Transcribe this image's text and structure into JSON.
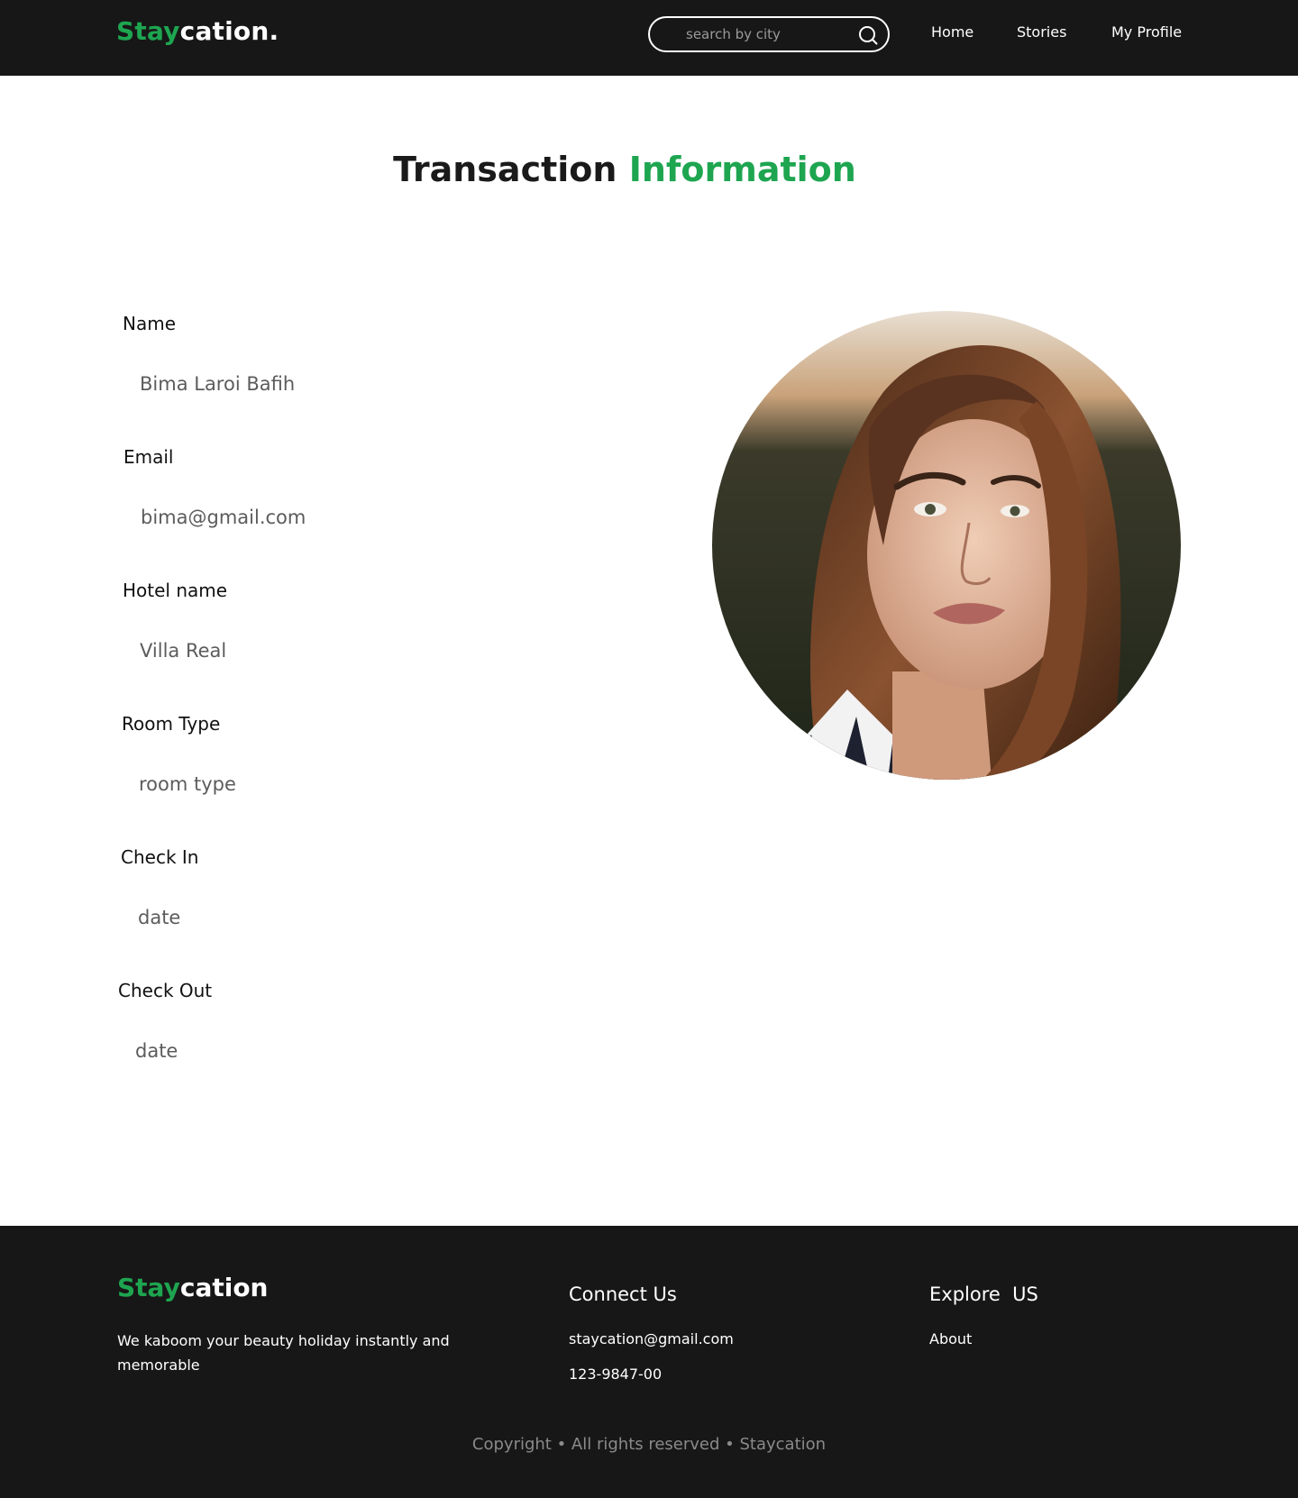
{
  "header": {
    "logo_accent": "Stay",
    "logo_rest": "cation.",
    "search": {
      "placeholder": "search by city"
    },
    "nav": {
      "home": "Home",
      "stories": "Stories",
      "profile": "My Profile"
    }
  },
  "title": {
    "part1": "Transaction",
    "part2": "Information"
  },
  "form": {
    "name": {
      "label": "Name",
      "value": "Bima Laroi Bafih"
    },
    "email": {
      "label": "Email",
      "value": "bima@gmail.com"
    },
    "hotel": {
      "label": "Hotel name",
      "value": "Villa Real"
    },
    "room": {
      "label": "Room Type",
      "value": "room type"
    },
    "checkin": {
      "label": "Check In",
      "value": "date"
    },
    "checkout": {
      "label": "Check Out",
      "value": "date"
    }
  },
  "footer": {
    "logo_accent": "Stay",
    "logo_rest": "cation",
    "tagline": "We kaboom your beauty holiday instantly and memorable",
    "connect": {
      "heading": "Connect Us",
      "email": "staycation@gmail.com",
      "phone": "123-9847-00"
    },
    "explore": {
      "heading": "Explore  US",
      "about": "About"
    },
    "copyright": "Copyright • All rights reserved • Staycation"
  },
  "colors": {
    "accent": "#1ea550",
    "dark_bg": "#171717",
    "muted_text": "#5c5c5c"
  }
}
